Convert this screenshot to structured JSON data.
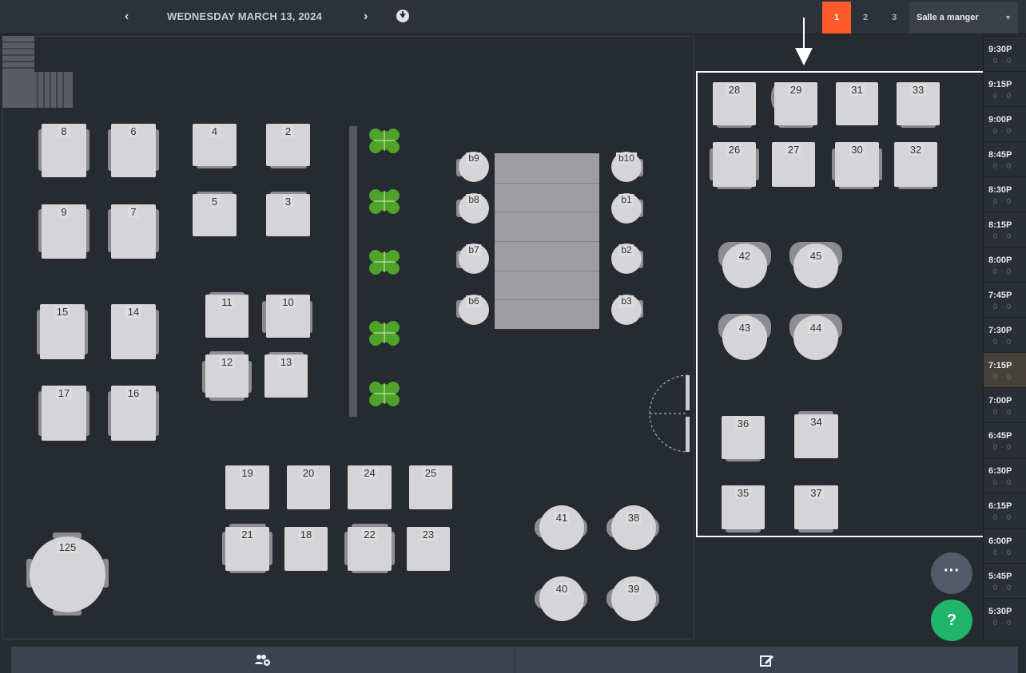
{
  "header": {
    "prev_label": "‹",
    "next_label": "›",
    "date": "WEDNESDAY MARCH 13, 2024"
  },
  "floor_tabs": [
    {
      "label": "1",
      "active": true
    },
    {
      "label": "2",
      "active": false
    },
    {
      "label": "3",
      "active": false
    }
  ],
  "room": {
    "selected": "Salle a manger",
    "caret": "▼"
  },
  "tables": {
    "t8": "8",
    "t6": "6",
    "t4": "4",
    "t2": "2",
    "t9": "9",
    "t7": "7",
    "t5": "5",
    "t3": "3",
    "t15": "15",
    "t14": "14",
    "t11": "11",
    "t10": "10",
    "t12": "12",
    "t13": "13",
    "t17": "17",
    "t16": "16",
    "t19": "19",
    "t20": "20",
    "t24": "24",
    "t25": "25",
    "t21": "21",
    "t18": "18",
    "t22": "22",
    "t23": "23",
    "t125": "125",
    "t41": "41",
    "t38": "38",
    "t40": "40",
    "t39": "39",
    "b9": "b9",
    "b8": "b8",
    "b7": "b7",
    "b6": "b6",
    "b10": "b10",
    "b1": "b1",
    "b2": "b2",
    "b3": "b3",
    "t28": "28",
    "t29": "29",
    "t31": "31",
    "t33": "33",
    "t26": "26",
    "t27": "27",
    "t30": "30",
    "t32": "32",
    "t42": "42",
    "t45": "45",
    "t43": "43",
    "t44": "44",
    "t36": "36",
    "t34": "34",
    "t35": "35",
    "t37": "37"
  },
  "timeline": [
    {
      "time": "9:30P",
      "count": "0 · 0"
    },
    {
      "time": "9:15P",
      "count": "0 · 0"
    },
    {
      "time": "9:00P",
      "count": "0 · 0"
    },
    {
      "time": "8:45P",
      "count": "0 · 0"
    },
    {
      "time": "8:30P",
      "count": "0 · 0"
    },
    {
      "time": "8:15P",
      "count": "0 · 0"
    },
    {
      "time": "8:00P",
      "count": "0 · 0"
    },
    {
      "time": "7:45P",
      "count": "0 · 0"
    },
    {
      "time": "7:30P",
      "count": "0 · 0"
    },
    {
      "time": "7:15P",
      "count": "0 · 0",
      "active": true
    },
    {
      "time": "7:00P",
      "count": "0 · 0"
    },
    {
      "time": "6:45P",
      "count": "0 · 0"
    },
    {
      "time": "6:30P",
      "count": "0 · 0"
    },
    {
      "time": "6:15P",
      "count": "0 · 0"
    },
    {
      "time": "6:00P",
      "count": "0 · 0"
    },
    {
      "time": "5:45P",
      "count": "0 · 0"
    },
    {
      "time": "5:30P",
      "count": "0 · 0"
    }
  ],
  "fab": {
    "more": "···",
    "help": "?"
  },
  "bottom": {
    "left_icon": "group-settings-icon",
    "right_icon": "edit-icon"
  },
  "colors": {
    "accent": "#ff5a2b",
    "help": "#20b66a",
    "table": "#d5d5d8"
  }
}
